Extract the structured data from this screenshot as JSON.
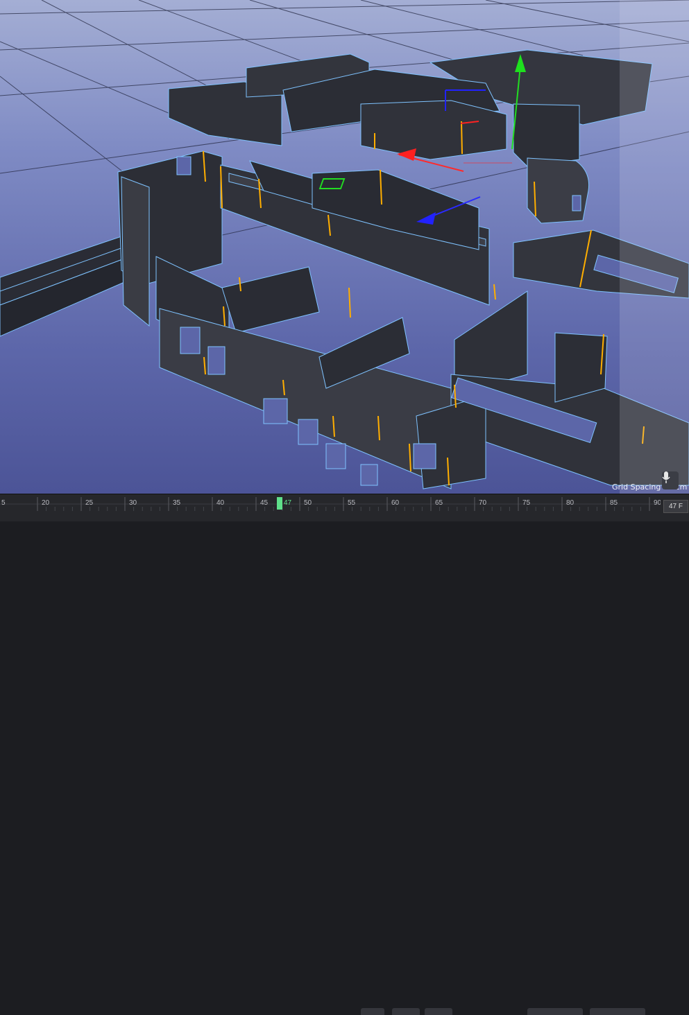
{
  "viewport": {
    "grid_spacing_label": "Grid Spacing : 5 cm",
    "axes": {
      "x": "red-arrow",
      "y": "green-arrow",
      "z": "blue-arrow"
    },
    "colors": {
      "background_top": "#a4aed4",
      "background_bottom": "#4c5497",
      "wall": "#2e3038",
      "wall_outline": "#7fc3ff",
      "edge_highlight": "#ffae00"
    }
  },
  "toolbar": {
    "mic_icon": "microphone-icon"
  },
  "timeline": {
    "ticks": [
      "5",
      "20",
      "25",
      "30",
      "35",
      "40",
      "45",
      "50",
      "55",
      "60",
      "65",
      "70",
      "75",
      "80",
      "85",
      "90"
    ],
    "current_frame_marker": "47",
    "current_frame_field": "47 F"
  }
}
